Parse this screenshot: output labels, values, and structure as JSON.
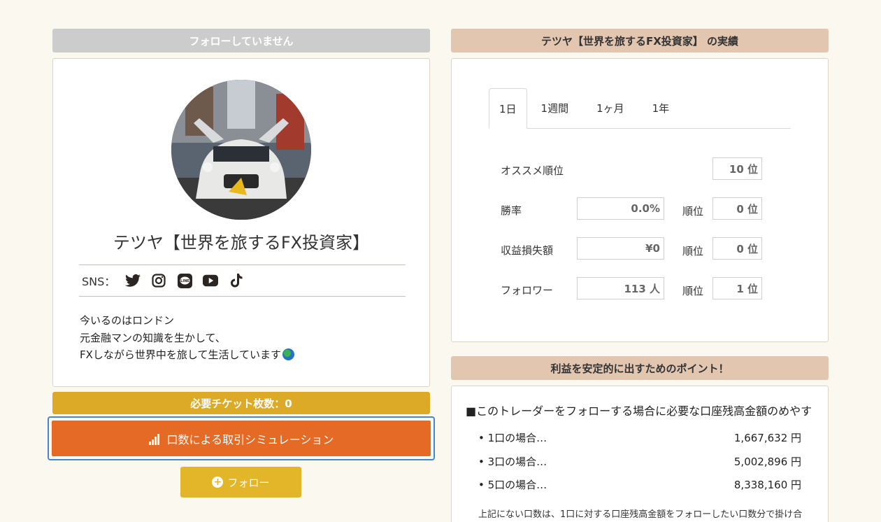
{
  "left": {
    "follow_status": "フォローしていません",
    "profile": {
      "name": "テツヤ【世界を旅するFX投資家】",
      "sns_label": "SNS：",
      "sns_icons": [
        "twitter-icon",
        "instagram-icon",
        "line-icon",
        "youtube-icon",
        "tiktok-icon"
      ],
      "bio": [
        "今いるのはロンドン",
        "元金融マンの知識を生かして、",
        "FXしながら世界中を旅して生活しています"
      ]
    },
    "ticket": "必要チケット枚数：0",
    "simulation_button": "口数による取引シミュレーション",
    "follow_button": "フォロー"
  },
  "right": {
    "performance_title": "テツヤ【世界を旅するFX投資家】 の実績",
    "tabs": [
      "1日",
      "1週間",
      "1ヶ月",
      "1年"
    ],
    "active_tab": "1日",
    "stats": {
      "recommend_label": "オススメ順位",
      "recommend_rank": "10 位",
      "winrate_label": "勝率",
      "winrate_value": "0.0%",
      "winrate_rank": "0 位",
      "profit_label": "収益損失額",
      "profit_value": "¥0",
      "profit_rank": "0 位",
      "followers_label": "フォロワー",
      "followers_value": "113 人",
      "followers_rank": "1 位",
      "rank_label": "順位"
    },
    "tips_title": "利益を安定的に出すためのポイント！",
    "tips_heading": "■このトレーダーをフォローする場合に必要な口座残高金額のめやす",
    "tips": [
      {
        "label": "• 1口の場合…",
        "value": "1,667,632 円"
      },
      {
        "label": "• 3口の場合…",
        "value": "5,002,896 円"
      },
      {
        "label": "• 5口の場合…",
        "value": "8,338,160 円"
      }
    ],
    "tips_note": "上記にない口数は、1口に対する口座残高金額をフォローしたい口数分で掛け合"
  },
  "colors": {
    "background": "#fbf8ef",
    "simulation_button": "#e56a26",
    "ticket_bar": "#dcaa26",
    "follow_button": "#e3b62a",
    "section_header": "#e2c6b0"
  }
}
